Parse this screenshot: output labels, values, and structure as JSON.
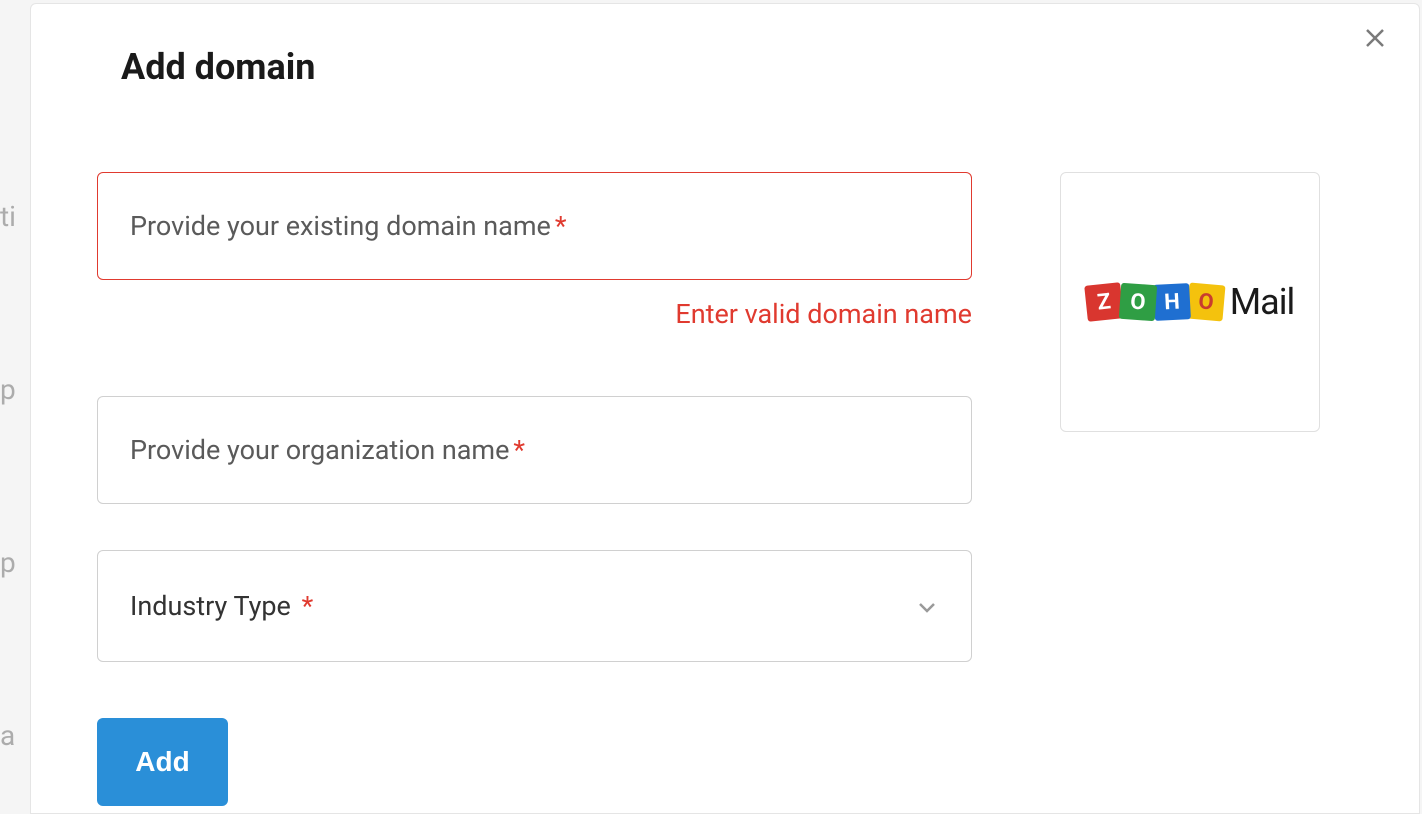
{
  "modal": {
    "title": "Add domain"
  },
  "form": {
    "domain": {
      "placeholder": "Provide your existing domain name",
      "required_marker": "*",
      "error": "Enter valid domain name"
    },
    "organization": {
      "placeholder": "Provide your organization name",
      "required_marker": "*"
    },
    "industry": {
      "label": "Industry Type",
      "required_marker": "*"
    },
    "submit_label": "Add"
  },
  "logo": {
    "letters": [
      "Z",
      "O",
      "H",
      "O"
    ],
    "brand_suffix": "Mail"
  }
}
